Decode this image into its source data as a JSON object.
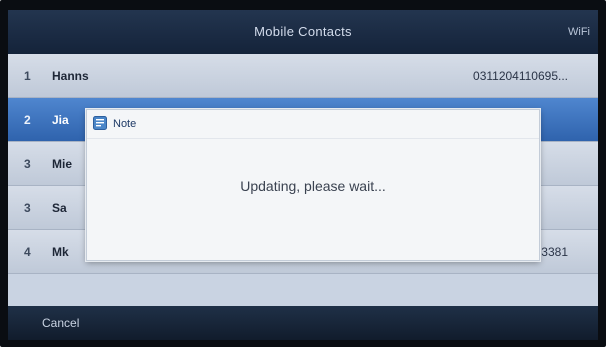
{
  "header": {
    "title": "Mobile Contacts",
    "right_label": "WiFi"
  },
  "contacts": [
    {
      "index": "1",
      "name": "Hanns",
      "number": "0311204110695..."
    },
    {
      "index": "2",
      "name": "Jia",
      "number": ""
    },
    {
      "index": "3",
      "name": "Mie",
      "number": ""
    },
    {
      "index": "3",
      "name": "Sa",
      "number": ""
    },
    {
      "index": "4",
      "name": "Mk",
      "number": "13746513381"
    }
  ],
  "selected_index": 1,
  "dialog": {
    "title": "Note",
    "message": "Updating, please wait..."
  },
  "softkeys": {
    "cancel": "Cancel"
  },
  "colors": {
    "title_bar": "#1b2b42",
    "row": "#c9d3e2",
    "selected_row": "#3d72bf",
    "dialog_bg": "#f4f6f8",
    "dialog_icon": "#4a86c8"
  },
  "icons": {
    "dialog_icon": "note-icon"
  }
}
